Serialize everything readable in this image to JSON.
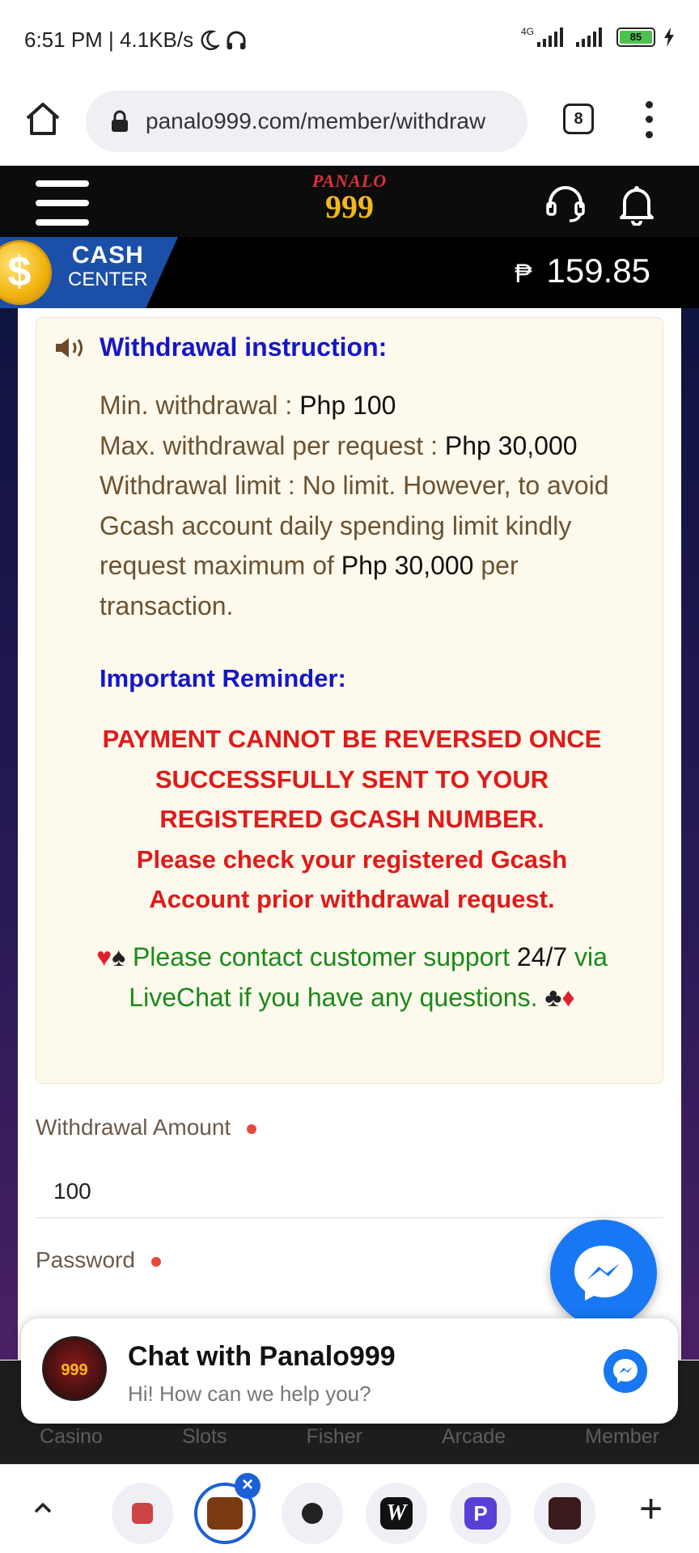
{
  "status_bar": {
    "time_speed": "6:51 PM | 4.1KB/s",
    "network": "4G",
    "battery": "85"
  },
  "browser": {
    "url": "panalo999.com/member/withdraw",
    "tab_count": "8"
  },
  "site": {
    "logo_top": "PANALO",
    "logo_number": "999"
  },
  "cash_center": {
    "line1": "CASH",
    "line2": "CENTER",
    "currency_symbol": "₱",
    "balance": "159.85"
  },
  "instructions": {
    "title": "Withdrawal instruction:",
    "min_label": "Min. withdrawal : ",
    "min_value": "Php 100",
    "max_label": "Max. withdrawal per request : ",
    "max_value": "Php 30,000",
    "limit_text": "Withdrawal limit : No limit. However, to avoid Gcash account daily spending limit kindly request maximum of ",
    "limit_value": "Php 30,000",
    "limit_tail": " per transaction.",
    "reminder_title": "Important Reminder:",
    "warning_1": "PAYMENT CANNOT BE REVERSED ONCE SUCCESSFULLY SENT TO YOUR REGISTERED GCASH NUMBER.",
    "warning_2": "Please check your registered Gcash Account prior withdrawal request.",
    "support_a": " Please contact customer support ",
    "support_247": "24/7",
    "support_b": " via LiveChat if you have any questions. ",
    "suit_heart": "♥",
    "suit_spade": "♠",
    "suit_club": "♣",
    "suit_diamond": "♦"
  },
  "form": {
    "amount_label": "Withdrawal Amount",
    "amount_value": "100",
    "password_label": "Password"
  },
  "bottom_nav": [
    "Casino",
    "Slots",
    "Fisher",
    "Arcade",
    "Member"
  ],
  "chat": {
    "avatar_text": "999",
    "title": "Chat with Panalo999",
    "subtitle": "Hi! How can we help you?"
  },
  "colors": {
    "accent_blue": "#1616c8",
    "warning_red": "#e01a1a",
    "support_green": "#1a8a1a",
    "messenger_blue": "#1877f2"
  }
}
